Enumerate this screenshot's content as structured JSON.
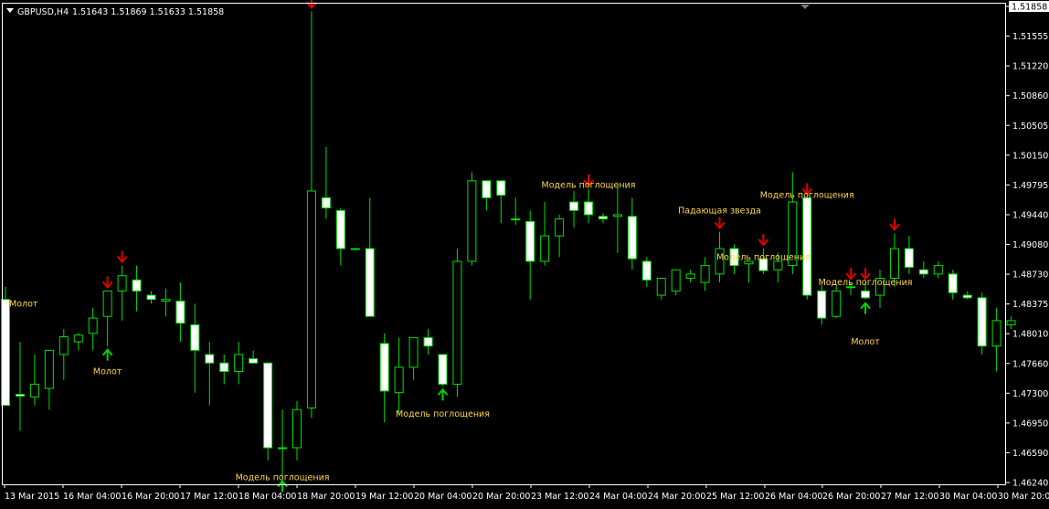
{
  "header": {
    "symbol": "GBPUSD,H4",
    "quote": "1.51643 1.51869 1.51633 1.51858"
  },
  "colors": {
    "background": "#000000",
    "grid_frame": "#ffffff",
    "candle_up_fill": "#000000",
    "candle_down_fill": "#ffffff",
    "candle_outline": "#00e000",
    "wick": "#00e000",
    "arrow_sell": "#e00000",
    "arrow_buy": "#00d000",
    "annotation_text": "#ffd84a",
    "axis_text": "#ffffff"
  },
  "chart_data": {
    "type": "candlestick",
    "ylim": [
      1.4624,
      1.51858
    ],
    "y_ticks": [
      "1.51858",
      "1.51555",
      "1.51220",
      "1.50860",
      "1.50505",
      "1.50150",
      "1.49795",
      "1.49440",
      "1.49080",
      "1.48730",
      "1.48375",
      "1.48010",
      "1.47660",
      "1.47300",
      "1.46950",
      "1.46590",
      "1.46240"
    ],
    "current_price": "1.51858",
    "x_ticks": [
      "13 Mar 2015",
      "16 Mar 04:00",
      "16 Mar 20:00",
      "17 Mar 12:00",
      "18 Mar 04:00",
      "18 Mar 20:00",
      "19 Mar 12:00",
      "20 Mar 04:00",
      "20 Mar 20:00",
      "23 Mar 12:00",
      "24 Mar 04:00",
      "24 Mar 20:00",
      "25 Mar 12:00",
      "26 Mar 04:00",
      "26 Mar 20:00",
      "27 Mar 12:00",
      "30 Mar 04:00",
      "30 Mar 20:00"
    ],
    "candles": [
      {
        "o": 1.484,
        "h": 1.4855,
        "l": 1.4715,
        "c": 1.4715
      },
      {
        "o": 1.4728,
        "h": 1.479,
        "l": 1.4685,
        "c": 1.4726
      },
      {
        "o": 1.4725,
        "h": 1.4775,
        "l": 1.4715,
        "c": 1.474
      },
      {
        "o": 1.4735,
        "h": 1.477,
        "l": 1.471,
        "c": 1.478
      },
      {
        "o": 1.4775,
        "h": 1.4805,
        "l": 1.4745,
        "c": 1.4796
      },
      {
        "o": 1.479,
        "h": 1.48,
        "l": 1.478,
        "c": 1.4798
      },
      {
        "o": 1.48,
        "h": 1.483,
        "l": 1.478,
        "c": 1.4818
      },
      {
        "o": 1.482,
        "h": 1.485,
        "l": 1.4785,
        "c": 1.485
      },
      {
        "o": 1.485,
        "h": 1.488,
        "l": 1.4815,
        "c": 1.4868
      },
      {
        "o": 1.4863,
        "h": 1.488,
        "l": 1.4826,
        "c": 1.485
      },
      {
        "o": 1.4845,
        "h": 1.485,
        "l": 1.4835,
        "c": 1.484
      },
      {
        "o": 1.4838,
        "h": 1.4853,
        "l": 1.482,
        "c": 1.484
      },
      {
        "o": 1.4838,
        "h": 1.486,
        "l": 1.479,
        "c": 1.4812
      },
      {
        "o": 1.481,
        "h": 1.4835,
        "l": 1.473,
        "c": 1.478
      },
      {
        "o": 1.4775,
        "h": 1.479,
        "l": 1.4715,
        "c": 1.4765
      },
      {
        "o": 1.4765,
        "h": 1.4775,
        "l": 1.474,
        "c": 1.4755
      },
      {
        "o": 1.4755,
        "h": 1.479,
        "l": 1.474,
        "c": 1.4775
      },
      {
        "o": 1.477,
        "h": 1.478,
        "l": 1.4765,
        "c": 1.4765
      },
      {
        "o": 1.4765,
        "h": 1.4765,
        "l": 1.465,
        "c": 1.4665
      },
      {
        "o": 1.4665,
        "h": 1.471,
        "l": 1.463,
        "c": 1.4665
      },
      {
        "o": 1.4665,
        "h": 1.472,
        "l": 1.465,
        "c": 1.471
      },
      {
        "o": 1.4712,
        "h": 1.518,
        "l": 1.47,
        "c": 1.4968
      },
      {
        "o": 1.496,
        "h": 1.502,
        "l": 1.4935,
        "c": 1.4948
      },
      {
        "o": 1.4945,
        "h": 1.4948,
        "l": 1.488,
        "c": 1.49
      },
      {
        "o": 1.49,
        "h": 1.49,
        "l": 1.49,
        "c": 1.49
      },
      {
        "o": 1.49,
        "h": 1.496,
        "l": 1.482,
        "c": 1.482
      },
      {
        "o": 1.4788,
        "h": 1.48,
        "l": 1.4695,
        "c": 1.4732
      },
      {
        "o": 1.473,
        "h": 1.4795,
        "l": 1.4705,
        "c": 1.476
      },
      {
        "o": 1.476,
        "h": 1.4795,
        "l": 1.4745,
        "c": 1.4795
      },
      {
        "o": 1.4795,
        "h": 1.4805,
        "l": 1.4775,
        "c": 1.4785
      },
      {
        "o": 1.4775,
        "h": 1.4775,
        "l": 1.4738,
        "c": 1.474
      },
      {
        "o": 1.474,
        "h": 1.49,
        "l": 1.4725,
        "c": 1.4885
      },
      {
        "o": 1.4885,
        "h": 1.499,
        "l": 1.488,
        "c": 1.498
      },
      {
        "o": 1.498,
        "h": 1.498,
        "l": 1.4945,
        "c": 1.496
      },
      {
        "o": 1.498,
        "h": 1.498,
        "l": 1.493,
        "c": 1.4963
      },
      {
        "o": 1.4935,
        "h": 1.496,
        "l": 1.4928,
        "c": 1.4935
      },
      {
        "o": 1.4932,
        "h": 1.4945,
        "l": 1.484,
        "c": 1.4885
      },
      {
        "o": 1.4885,
        "h": 1.4955,
        "l": 1.488,
        "c": 1.4915
      },
      {
        "o": 1.4915,
        "h": 1.494,
        "l": 1.489,
        "c": 1.4935
      },
      {
        "o": 1.4955,
        "h": 1.4968,
        "l": 1.4925,
        "c": 1.4945
      },
      {
        "o": 1.4955,
        "h": 1.497,
        "l": 1.493,
        "c": 1.494
      },
      {
        "o": 1.4938,
        "h": 1.4942,
        "l": 1.493,
        "c": 1.4935
      },
      {
        "o": 1.4938,
        "h": 1.4975,
        "l": 1.4895,
        "c": 1.494
      },
      {
        "o": 1.4938,
        "h": 1.496,
        "l": 1.4875,
        "c": 1.4888
      },
      {
        "o": 1.4885,
        "h": 1.489,
        "l": 1.4855,
        "c": 1.4863
      },
      {
        "o": 1.4845,
        "h": 1.4865,
        "l": 1.484,
        "c": 1.4865
      },
      {
        "o": 1.485,
        "h": 1.4875,
        "l": 1.4845,
        "c": 1.4875
      },
      {
        "o": 1.4865,
        "h": 1.4875,
        "l": 1.486,
        "c": 1.487
      },
      {
        "o": 1.486,
        "h": 1.489,
        "l": 1.485,
        "c": 1.488
      },
      {
        "o": 1.487,
        "h": 1.492,
        "l": 1.486,
        "c": 1.49
      },
      {
        "o": 1.49,
        "h": 1.4905,
        "l": 1.487,
        "c": 1.488
      },
      {
        "o": 1.4882,
        "h": 1.4885,
        "l": 1.486,
        "c": 1.4885
      },
      {
        "o": 1.4888,
        "h": 1.49,
        "l": 1.487,
        "c": 1.4874
      },
      {
        "o": 1.4875,
        "h": 1.4895,
        "l": 1.486,
        "c": 1.4885
      },
      {
        "o": 1.488,
        "h": 1.499,
        "l": 1.487,
        "c": 1.4955
      },
      {
        "o": 1.496,
        "h": 1.496,
        "l": 1.484,
        "c": 1.4845
      },
      {
        "o": 1.485,
        "h": 1.4858,
        "l": 1.481,
        "c": 1.4818
      },
      {
        "o": 1.482,
        "h": 1.4855,
        "l": 1.4818,
        "c": 1.485
      },
      {
        "o": 1.4855,
        "h": 1.486,
        "l": 1.4845,
        "c": 1.4855
      },
      {
        "o": 1.485,
        "h": 1.486,
        "l": 1.484,
        "c": 1.4842
      },
      {
        "o": 1.4845,
        "h": 1.4875,
        "l": 1.483,
        "c": 1.4865
      },
      {
        "o": 1.4865,
        "h": 1.4918,
        "l": 1.4855,
        "c": 1.49
      },
      {
        "o": 1.49,
        "h": 1.4915,
        "l": 1.487,
        "c": 1.4878
      },
      {
        "o": 1.4875,
        "h": 1.4885,
        "l": 1.4865,
        "c": 1.487
      },
      {
        "o": 1.487,
        "h": 1.4885,
        "l": 1.4865,
        "c": 1.488
      },
      {
        "o": 1.487,
        "h": 1.4875,
        "l": 1.484,
        "c": 1.4848
      },
      {
        "o": 1.4845,
        "h": 1.485,
        "l": 1.484,
        "c": 1.4842
      },
      {
        "o": 1.4842,
        "h": 1.4848,
        "l": 1.4775,
        "c": 1.4785
      },
      {
        "o": 1.4785,
        "h": 1.483,
        "l": 1.4755,
        "c": 1.4815
      },
      {
        "o": 1.481,
        "h": 1.482,
        "l": 1.4805,
        "c": 1.4815
      }
    ],
    "annotations": [
      {
        "text": "Молот",
        "candle": 0,
        "price": 1.4835,
        "side": "left"
      },
      {
        "text": "Молот",
        "candle": 7,
        "price": 1.4755
      },
      {
        "text": "Модель поглощения",
        "candle": 19,
        "price": 1.463
      },
      {
        "text": "Модель поглощения",
        "candle": 30,
        "price": 1.4705
      },
      {
        "text": "Модель поглощения",
        "candle": 40,
        "price": 1.4975
      },
      {
        "text": "Падающая звезда",
        "candle": 49,
        "price": 1.4945
      },
      {
        "text": "Модель поглощения",
        "candle": 52,
        "price": 1.489
      },
      {
        "text": "Модель поглощения",
        "candle": 55,
        "price": 1.4963
      },
      {
        "text": "Модель поглощения",
        "candle": 59,
        "price": 1.486
      },
      {
        "text": "Молот",
        "candle": 59,
        "price": 1.479
      }
    ],
    "signals": [
      {
        "candle": 7,
        "dir": "down"
      },
      {
        "candle": 8,
        "dir": "down"
      },
      {
        "candle": 7,
        "dir": "up"
      },
      {
        "candle": 21,
        "dir": "down"
      },
      {
        "candle": 19,
        "dir": "up"
      },
      {
        "candle": 30,
        "dir": "up"
      },
      {
        "candle": 40,
        "dir": "down"
      },
      {
        "candle": 49,
        "dir": "down"
      },
      {
        "candle": 52,
        "dir": "down"
      },
      {
        "candle": 55,
        "dir": "down"
      },
      {
        "candle": 58,
        "dir": "down"
      },
      {
        "candle": 59,
        "dir": "down"
      },
      {
        "candle": 61,
        "dir": "down"
      },
      {
        "candle": 59,
        "dir": "up"
      }
    ]
  }
}
